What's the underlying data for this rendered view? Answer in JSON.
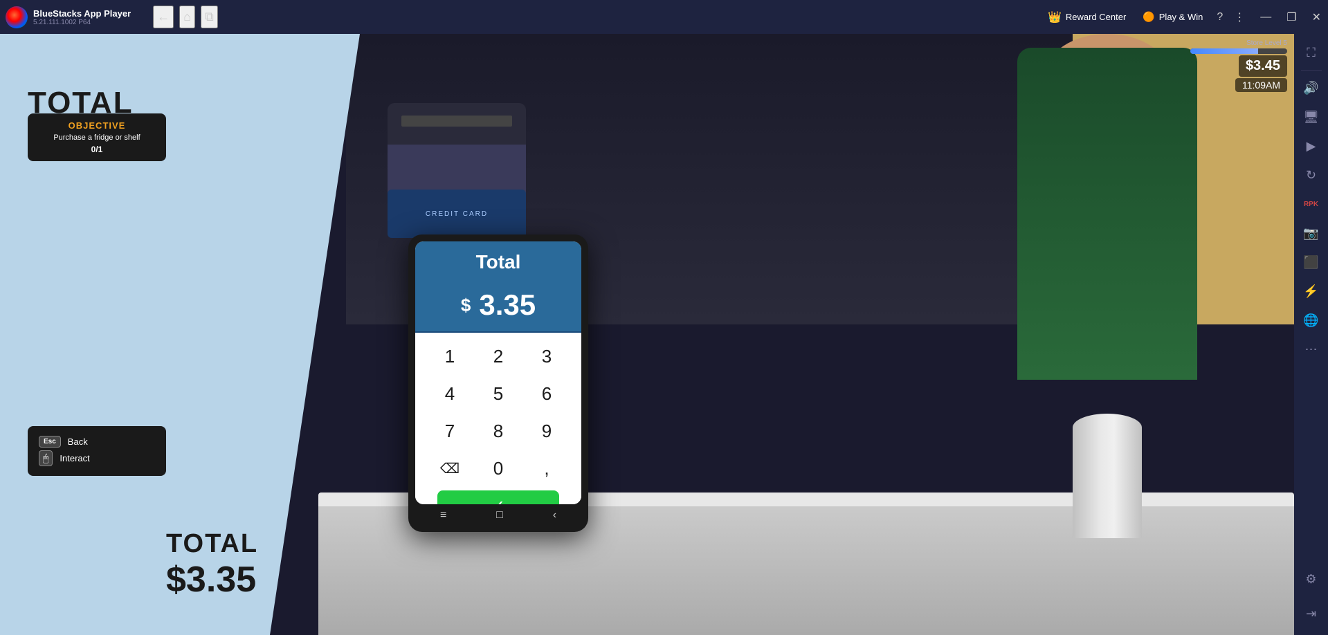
{
  "titlebar": {
    "app_name": "BlueStacks App Player",
    "version": "5.21.111.1002  P64",
    "logo_alt": "bluestacks-logo",
    "nav": {
      "back_label": "←",
      "home_label": "⌂",
      "menu_label": "☰"
    },
    "reward_center_label": "Reward Center",
    "play_win_label": "Play & Win",
    "help_label": "?",
    "more_label": "⋮",
    "minimize_label": "—",
    "restore_label": "❐",
    "close_label": "✕"
  },
  "hud": {
    "money": "$3.45",
    "time": "11:09AM",
    "store_level": "Store Level 5",
    "level_fill_percent": 70
  },
  "game": {
    "total_label_top": "TOTAL",
    "total_label_bottom": "TOTAL",
    "total_amount": "$3.35",
    "objective": {
      "title": "OBJECTIVE",
      "description": "Purchase a fridge or shelf",
      "progress": "0/1"
    },
    "controls": {
      "esc_label": "Esc",
      "back_label": "Back",
      "mouse_label": "🖱",
      "interact_label": "Interact"
    }
  },
  "pos": {
    "total_label": "Total",
    "dollar_sign": "$",
    "amount": "3.35",
    "card_reader_text": "CREDIT CARD",
    "keypad": {
      "keys": [
        "1",
        "2",
        "3",
        "4",
        "5",
        "6",
        "7",
        "8",
        "9",
        "⌫",
        "0",
        ","
      ]
    },
    "confirm_icon": "✓",
    "nav_icons": [
      "≡",
      "□",
      "‹"
    ]
  },
  "sidebar": {
    "icons": [
      "⛶",
      "🔊",
      "📺",
      "▶",
      "🔄",
      "RPK",
      "📷",
      "⬛",
      "⚡",
      "🌐",
      "⋯",
      "⚙",
      "⇥"
    ]
  }
}
